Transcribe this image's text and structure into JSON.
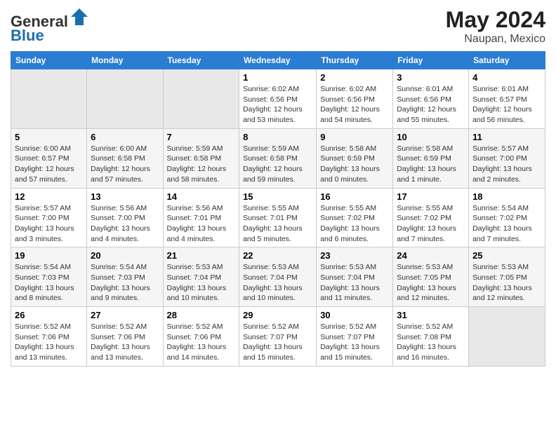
{
  "header": {
    "logo_line1": "General",
    "logo_line2": "Blue",
    "title": "May 2024",
    "subtitle": "Naupan, Mexico"
  },
  "weekdays": [
    "Sunday",
    "Monday",
    "Tuesday",
    "Wednesday",
    "Thursday",
    "Friday",
    "Saturday"
  ],
  "weeks": [
    [
      {
        "day": "",
        "info": ""
      },
      {
        "day": "",
        "info": ""
      },
      {
        "day": "",
        "info": ""
      },
      {
        "day": "1",
        "info": "Sunrise: 6:02 AM\nSunset: 6:56 PM\nDaylight: 12 hours and 53 minutes."
      },
      {
        "day": "2",
        "info": "Sunrise: 6:02 AM\nSunset: 6:56 PM\nDaylight: 12 hours and 54 minutes."
      },
      {
        "day": "3",
        "info": "Sunrise: 6:01 AM\nSunset: 6:56 PM\nDaylight: 12 hours and 55 minutes."
      },
      {
        "day": "4",
        "info": "Sunrise: 6:01 AM\nSunset: 6:57 PM\nDaylight: 12 hours and 56 minutes."
      }
    ],
    [
      {
        "day": "5",
        "info": "Sunrise: 6:00 AM\nSunset: 6:57 PM\nDaylight: 12 hours and 57 minutes."
      },
      {
        "day": "6",
        "info": "Sunrise: 6:00 AM\nSunset: 6:58 PM\nDaylight: 12 hours and 57 minutes."
      },
      {
        "day": "7",
        "info": "Sunrise: 5:59 AM\nSunset: 6:58 PM\nDaylight: 12 hours and 58 minutes."
      },
      {
        "day": "8",
        "info": "Sunrise: 5:59 AM\nSunset: 6:58 PM\nDaylight: 12 hours and 59 minutes."
      },
      {
        "day": "9",
        "info": "Sunrise: 5:58 AM\nSunset: 6:59 PM\nDaylight: 13 hours and 0 minutes."
      },
      {
        "day": "10",
        "info": "Sunrise: 5:58 AM\nSunset: 6:59 PM\nDaylight: 13 hours and 1 minute."
      },
      {
        "day": "11",
        "info": "Sunrise: 5:57 AM\nSunset: 7:00 PM\nDaylight: 13 hours and 2 minutes."
      }
    ],
    [
      {
        "day": "12",
        "info": "Sunrise: 5:57 AM\nSunset: 7:00 PM\nDaylight: 13 hours and 3 minutes."
      },
      {
        "day": "13",
        "info": "Sunrise: 5:56 AM\nSunset: 7:00 PM\nDaylight: 13 hours and 4 minutes."
      },
      {
        "day": "14",
        "info": "Sunrise: 5:56 AM\nSunset: 7:01 PM\nDaylight: 13 hours and 4 minutes."
      },
      {
        "day": "15",
        "info": "Sunrise: 5:55 AM\nSunset: 7:01 PM\nDaylight: 13 hours and 5 minutes."
      },
      {
        "day": "16",
        "info": "Sunrise: 5:55 AM\nSunset: 7:02 PM\nDaylight: 13 hours and 6 minutes."
      },
      {
        "day": "17",
        "info": "Sunrise: 5:55 AM\nSunset: 7:02 PM\nDaylight: 13 hours and 7 minutes."
      },
      {
        "day": "18",
        "info": "Sunrise: 5:54 AM\nSunset: 7:02 PM\nDaylight: 13 hours and 7 minutes."
      }
    ],
    [
      {
        "day": "19",
        "info": "Sunrise: 5:54 AM\nSunset: 7:03 PM\nDaylight: 13 hours and 8 minutes."
      },
      {
        "day": "20",
        "info": "Sunrise: 5:54 AM\nSunset: 7:03 PM\nDaylight: 13 hours and 9 minutes."
      },
      {
        "day": "21",
        "info": "Sunrise: 5:53 AM\nSunset: 7:04 PM\nDaylight: 13 hours and 10 minutes."
      },
      {
        "day": "22",
        "info": "Sunrise: 5:53 AM\nSunset: 7:04 PM\nDaylight: 13 hours and 10 minutes."
      },
      {
        "day": "23",
        "info": "Sunrise: 5:53 AM\nSunset: 7:04 PM\nDaylight: 13 hours and 11 minutes."
      },
      {
        "day": "24",
        "info": "Sunrise: 5:53 AM\nSunset: 7:05 PM\nDaylight: 13 hours and 12 minutes."
      },
      {
        "day": "25",
        "info": "Sunrise: 5:53 AM\nSunset: 7:05 PM\nDaylight: 13 hours and 12 minutes."
      }
    ],
    [
      {
        "day": "26",
        "info": "Sunrise: 5:52 AM\nSunset: 7:06 PM\nDaylight: 13 hours and 13 minutes."
      },
      {
        "day": "27",
        "info": "Sunrise: 5:52 AM\nSunset: 7:06 PM\nDaylight: 13 hours and 13 minutes."
      },
      {
        "day": "28",
        "info": "Sunrise: 5:52 AM\nSunset: 7:06 PM\nDaylight: 13 hours and 14 minutes."
      },
      {
        "day": "29",
        "info": "Sunrise: 5:52 AM\nSunset: 7:07 PM\nDaylight: 13 hours and 15 minutes."
      },
      {
        "day": "30",
        "info": "Sunrise: 5:52 AM\nSunset: 7:07 PM\nDaylight: 13 hours and 15 minutes."
      },
      {
        "day": "31",
        "info": "Sunrise: 5:52 AM\nSunset: 7:08 PM\nDaylight: 13 hours and 16 minutes."
      },
      {
        "day": "",
        "info": ""
      }
    ]
  ]
}
